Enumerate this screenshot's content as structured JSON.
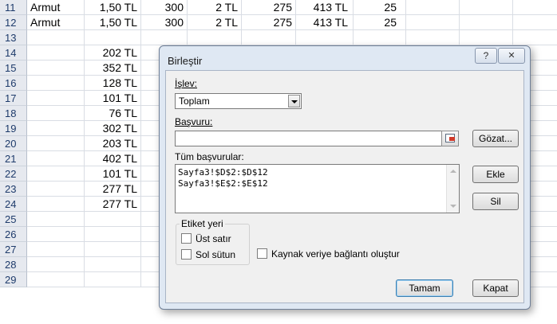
{
  "sheet": {
    "rows": [
      {
        "num": "11",
        "cells": [
          "Armut",
          "1,50 TL",
          "300",
          "2 TL",
          "275",
          "413 TL",
          "25"
        ]
      },
      {
        "num": "12",
        "cells": [
          "Armut",
          "1,50 TL",
          "300",
          "2 TL",
          "275",
          "413 TL",
          "25"
        ]
      },
      {
        "num": "13",
        "cells": [
          "",
          "",
          "",
          "",
          "",
          "",
          ""
        ]
      },
      {
        "num": "14",
        "cells": [
          "",
          "202 TL",
          "",
          "",
          "",
          "",
          ""
        ]
      },
      {
        "num": "15",
        "cells": [
          "",
          "352 TL",
          "",
          "",
          "",
          "",
          ""
        ]
      },
      {
        "num": "16",
        "cells": [
          "",
          "128 TL",
          "",
          "",
          "",
          "",
          ""
        ]
      },
      {
        "num": "17",
        "cells": [
          "",
          "101 TL",
          "",
          "",
          "",
          "",
          ""
        ]
      },
      {
        "num": "18",
        "cells": [
          "",
          "76 TL",
          "",
          "",
          "",
          "",
          ""
        ]
      },
      {
        "num": "19",
        "cells": [
          "",
          "302 TL",
          "",
          "",
          "",
          "",
          ""
        ]
      },
      {
        "num": "20",
        "cells": [
          "",
          "203 TL",
          "",
          "",
          "",
          "",
          ""
        ]
      },
      {
        "num": "21",
        "cells": [
          "",
          "402 TL",
          "",
          "",
          "",
          "",
          ""
        ]
      },
      {
        "num": "22",
        "cells": [
          "",
          "101 TL",
          "",
          "",
          "",
          "",
          ""
        ]
      },
      {
        "num": "23",
        "cells": [
          "",
          "277 TL",
          "",
          "",
          "",
          "",
          ""
        ]
      },
      {
        "num": "24",
        "cells": [
          "",
          "277 TL",
          "",
          "",
          "",
          "",
          ""
        ]
      },
      {
        "num": "25",
        "cells": [
          "",
          "",
          "",
          "",
          "",
          "",
          ""
        ]
      },
      {
        "num": "26",
        "cells": [
          "",
          "",
          "",
          "",
          "",
          "",
          ""
        ]
      },
      {
        "num": "27",
        "cells": [
          "",
          "",
          "",
          "",
          "",
          "",
          ""
        ]
      },
      {
        "num": "28",
        "cells": [
          "",
          "",
          "",
          "",
          "",
          "",
          ""
        ]
      },
      {
        "num": "29",
        "cells": [
          "",
          "",
          "",
          "",
          "",
          "",
          ""
        ]
      }
    ]
  },
  "dialog": {
    "title": "Birleştir",
    "help_glyph": "?",
    "close_glyph": "✕",
    "function_label": "İşlev:",
    "function_value": "Toplam",
    "reference_label": "Başvuru:",
    "reference_value": "",
    "browse_label": "Gözat...",
    "all_references_label": "Tüm başvurular:",
    "all_references": [
      "Sayfa3!$D$2:$D$12",
      "Sayfa3!$E$2:$E$12"
    ],
    "add_label": "Ekle",
    "delete_label": "Sil",
    "labels_group_title": "Etiket yeri",
    "top_row_label": "Üst satır",
    "left_column_label": "Sol sütun",
    "link_label": "Kaynak veriye bağlantı oluştur",
    "ok_label": "Tamam",
    "cancel_label": "Kapat"
  }
}
